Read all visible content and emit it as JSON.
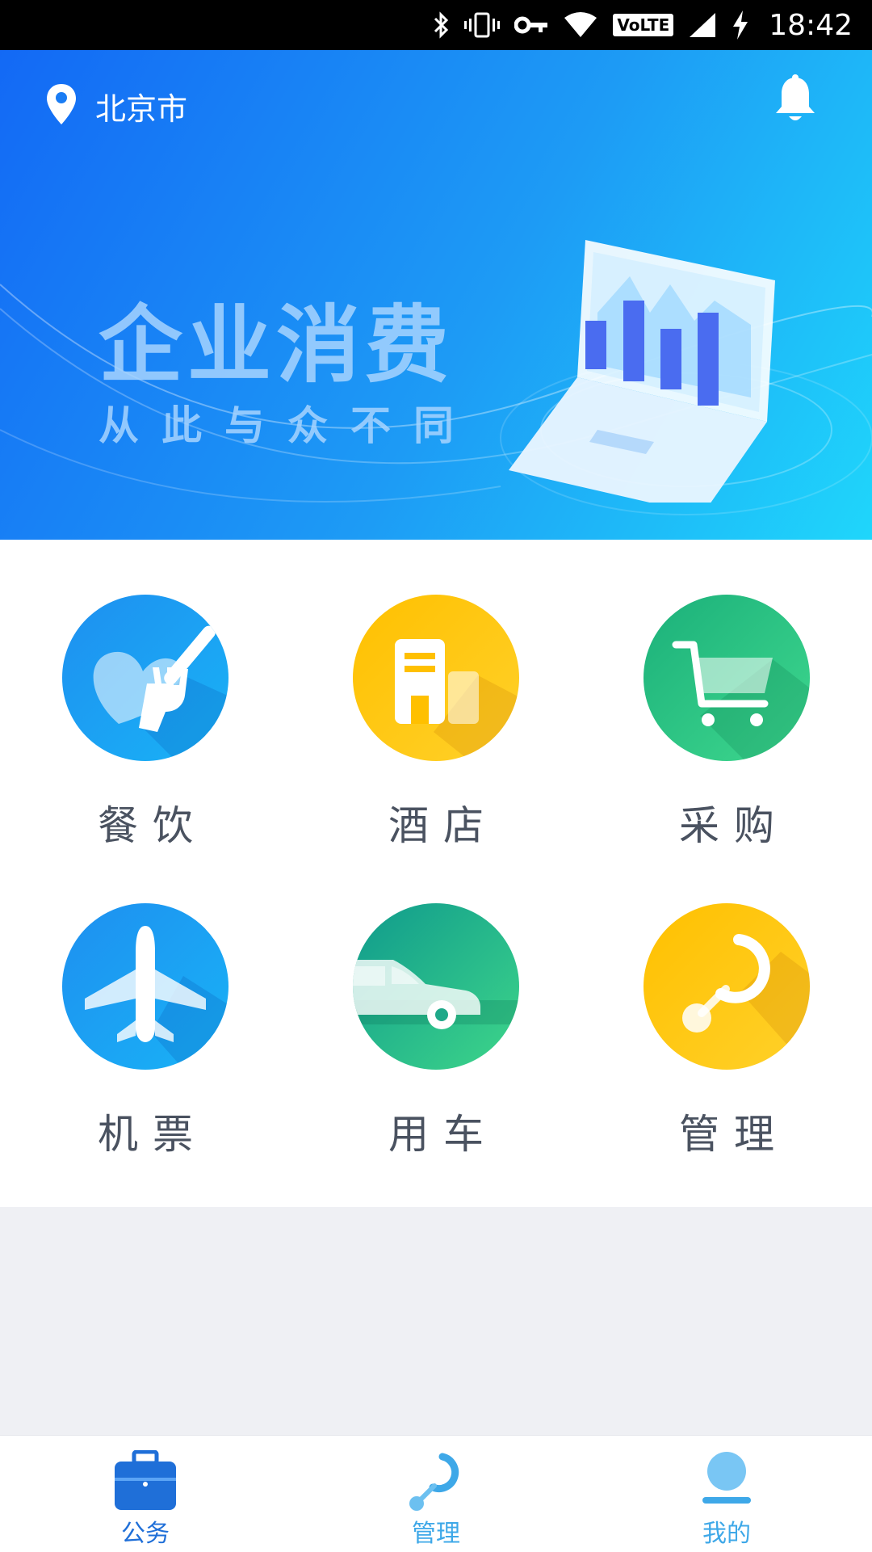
{
  "status_bar": {
    "time": "18:42",
    "volte": "VoLTE",
    "icons": [
      "bluetooth-icon",
      "vibrate-icon",
      "vpn-key-icon",
      "wifi-icon",
      "volte-icon",
      "signal-icon",
      "charging-icon"
    ]
  },
  "banner": {
    "location": "北京市",
    "headline": "企业消费",
    "subline": "从此与众不同"
  },
  "services": [
    {
      "label": "餐饮",
      "icon": "dining-icon",
      "color": "#1e8ff0"
    },
    {
      "label": "酒店",
      "icon": "hotel-icon",
      "color": "#ffc000"
    },
    {
      "label": "采购",
      "icon": "shopping-cart-icon",
      "color": "#1bb07a"
    },
    {
      "label": "机票",
      "icon": "airplane-icon",
      "color": "#1e8ff0"
    },
    {
      "label": "用车",
      "icon": "car-icon",
      "color": "#0f9a8c"
    },
    {
      "label": "管理",
      "icon": "management-icon",
      "color": "#ffc000"
    }
  ],
  "bottom_nav": {
    "items": [
      {
        "label": "公务",
        "icon": "briefcase-icon",
        "color": "#1f6fd8",
        "active": true
      },
      {
        "label": "管理",
        "icon": "management-icon",
        "color": "#3ea8e8",
        "active": false
      },
      {
        "label": "我的",
        "icon": "user-icon",
        "color": "#3ea8e8",
        "active": false
      }
    ]
  }
}
